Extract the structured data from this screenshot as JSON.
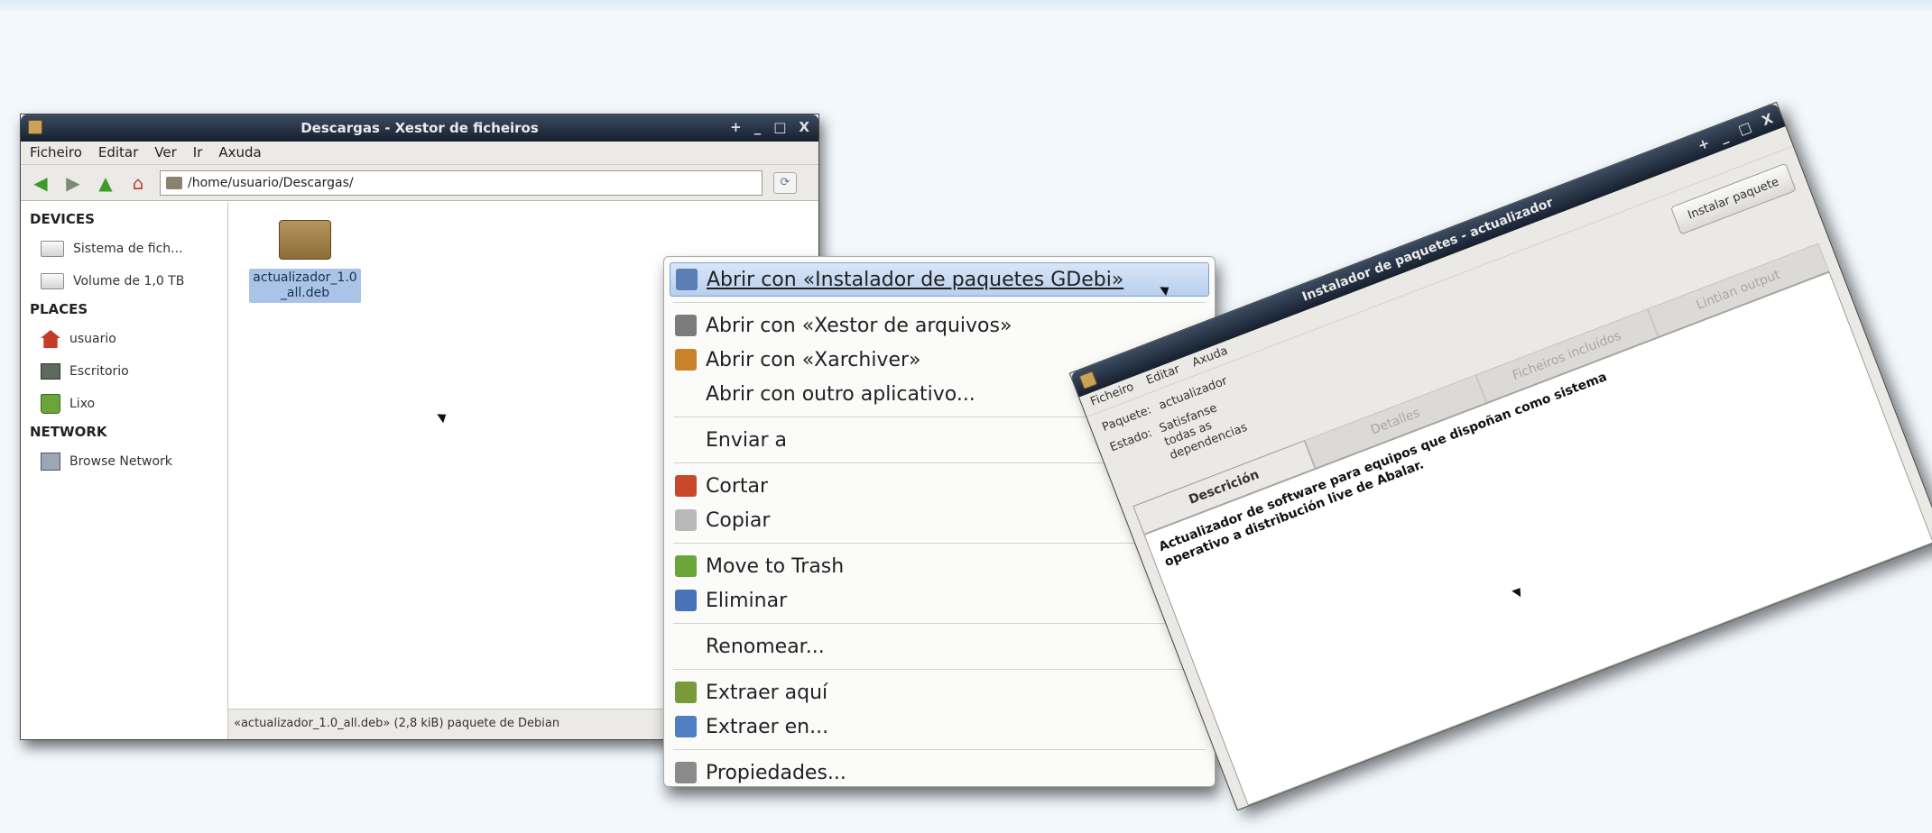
{
  "file_manager": {
    "title": "Descargas - Xestor de ficheiros",
    "window_buttons": [
      "+",
      "_",
      "□",
      "X"
    ],
    "menu": [
      "Ficheiro",
      "Editar",
      "Ver",
      "Ir",
      "Axuda"
    ],
    "location": "/home/usuario/Descargas/",
    "sidebar": {
      "devices_heading": "DEVICES",
      "devices": [
        "Sistema de fich...",
        "Volume de 1,0 TB"
      ],
      "places_heading": "PLACES",
      "places": [
        "usuario",
        "Escritorio",
        "Lixo"
      ],
      "network_heading": "NETWORK",
      "network": [
        "Browse Network"
      ]
    },
    "file": {
      "name_line1": "actualizador_1.0",
      "name_line2": "_all.deb"
    },
    "status": "«actualizador_1.0_all.deb» (2,8 kiB) paquete de Debian"
  },
  "context_menu": {
    "items": [
      {
        "label": "Abrir con «Instalador de paquetes GDebi»",
        "icon": "gdebi-icon",
        "color": "#5b7fb5"
      },
      {
        "label": "Abrir con «Xestor de arquivos»",
        "icon": "archive-icon",
        "color": "#7b7b7b"
      },
      {
        "label": "Abrir con «Xarchiver»",
        "icon": "xarchiver-icon",
        "color": "#c9822c"
      },
      {
        "label": "Abrir con outro aplicativo...",
        "icon": "",
        "color": ""
      },
      {
        "label": "Enviar a",
        "icon": "",
        "color": ""
      },
      {
        "label": "Cortar",
        "icon": "scissors-icon",
        "color": "#c9482c"
      },
      {
        "label": "Copiar",
        "icon": "copy-icon",
        "color": "#b9b9b9"
      },
      {
        "label": "Move to Trash",
        "icon": "trash-icon",
        "color": "#6aa53b"
      },
      {
        "label": "Eliminar",
        "icon": "delete-icon",
        "color": "#4a72b8"
      },
      {
        "label": "Renomear...",
        "icon": "",
        "color": ""
      },
      {
        "label": "Extraer aquí",
        "icon": "extract-icon",
        "color": "#7a9a3a"
      },
      {
        "label": "Extraer en...",
        "icon": "extract-to-icon",
        "color": "#4f7fc2"
      },
      {
        "label": "Propiedades...",
        "icon": "properties-icon",
        "color": "#8a8a8a"
      }
    ]
  },
  "gdebi": {
    "title": "Instalador de paquetes - actualizador",
    "window_buttons": [
      "+",
      "_",
      "□",
      "X"
    ],
    "menu": [
      "Ficheiro",
      "Editar",
      "Axuda"
    ],
    "package_label": "Paquete:",
    "package_value": "actualizador",
    "status_label": "Estado:",
    "status_value_1": "Satisfanse",
    "status_value_2": "todas as",
    "status_value_3": "dependencias",
    "install_button": "Instalar paquete",
    "tabs": [
      "Descrición",
      "Detalles",
      "Ficheiros incluídos",
      "Lintian output"
    ],
    "description_line1": "Actualizador de software para equipos que dispoñan como sistema",
    "description_line2": "operativo a distribución live de Abalar."
  }
}
